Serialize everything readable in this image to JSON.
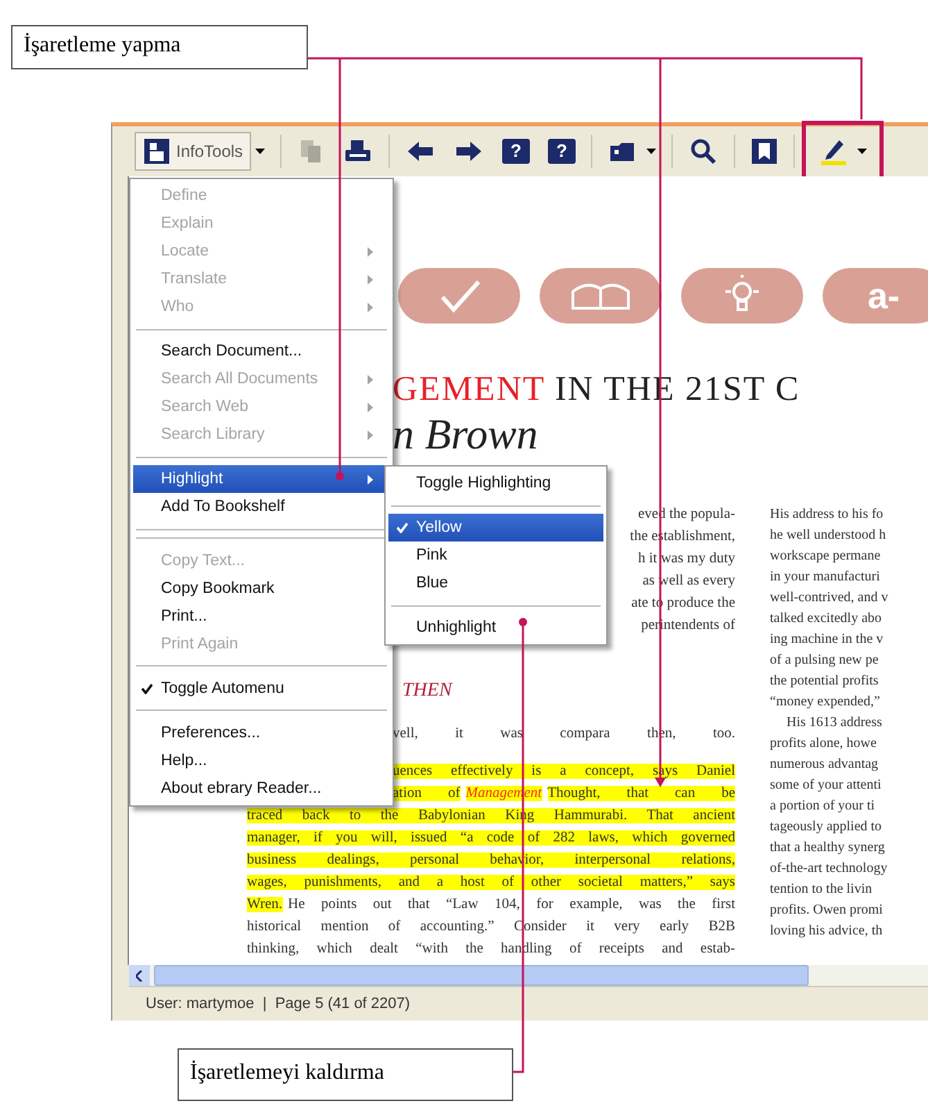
{
  "top_callout": {
    "text": "İşaretleme yapma"
  },
  "toolbar": {
    "items": [
      {
        "kind": "infotools",
        "label": "InfoTools",
        "dropdown": true,
        "disabled": false,
        "annotated": false
      },
      {
        "kind": "copy",
        "dropdown": false,
        "disabled": true,
        "annotated": false
      },
      {
        "kind": "print",
        "dropdown": false,
        "disabled": false,
        "annotated": false
      },
      {
        "kind": "back",
        "dropdown": false,
        "disabled": false,
        "annotated": false
      },
      {
        "kind": "forward",
        "dropdown": false,
        "disabled": false,
        "annotated": false
      },
      {
        "kind": "help-back",
        "glyph": "?",
        "dropdown": false,
        "disabled": false,
        "annotated": false
      },
      {
        "kind": "help-forward",
        "glyph": "?",
        "dropdown": false,
        "disabled": false,
        "annotated": false
      },
      {
        "kind": "bookmark",
        "dropdown": true,
        "disabled": false,
        "annotated": false
      },
      {
        "kind": "zoom",
        "dropdown": false,
        "disabled": false,
        "annotated": false
      },
      {
        "kind": "bookshelf",
        "dropdown": false,
        "disabled": false,
        "annotated": false
      },
      {
        "kind": "highlighter",
        "dropdown": true,
        "disabled": false,
        "annotated": true
      }
    ]
  },
  "context_menu": {
    "items": [
      {
        "kind": "item",
        "label": "Define",
        "disabled": true,
        "submenu": false,
        "checked": false,
        "selected": false
      },
      {
        "kind": "item",
        "label": "Explain",
        "disabled": true,
        "submenu": false,
        "checked": false,
        "selected": false
      },
      {
        "kind": "item",
        "label": "Locate",
        "disabled": true,
        "submenu": true,
        "checked": false,
        "selected": false
      },
      {
        "kind": "item",
        "label": "Translate",
        "disabled": true,
        "submenu": true,
        "checked": false,
        "selected": false
      },
      {
        "kind": "item",
        "label": "Who",
        "disabled": true,
        "submenu": true,
        "checked": false,
        "selected": false
      },
      {
        "kind": "separator"
      },
      {
        "kind": "item",
        "label": "Search Document...",
        "disabled": false,
        "submenu": false,
        "checked": false,
        "selected": false
      },
      {
        "kind": "item",
        "label": "Search All Documents",
        "disabled": true,
        "submenu": true,
        "checked": false,
        "selected": false
      },
      {
        "kind": "item",
        "label": "Search Web",
        "disabled": true,
        "submenu": true,
        "checked": false,
        "selected": false
      },
      {
        "kind": "item",
        "label": "Search Library",
        "disabled": true,
        "submenu": true,
        "checked": false,
        "selected": false
      },
      {
        "kind": "separator"
      },
      {
        "kind": "item",
        "label": "Highlight",
        "disabled": false,
        "submenu": true,
        "checked": false,
        "selected": true
      },
      {
        "kind": "item",
        "label": "Add To Bookshelf",
        "disabled": false,
        "submenu": false,
        "checked": false,
        "selected": false
      },
      {
        "kind": "separator"
      },
      {
        "kind": "separator"
      },
      {
        "kind": "item",
        "label": "Copy Text...",
        "disabled": true,
        "submenu": false,
        "checked": false,
        "selected": false
      },
      {
        "kind": "item",
        "label": "Copy Bookmark",
        "disabled": false,
        "submenu": false,
        "checked": false,
        "selected": false
      },
      {
        "kind": "item",
        "label": "Print...",
        "disabled": false,
        "submenu": false,
        "checked": false,
        "selected": false
      },
      {
        "kind": "item",
        "label": "Print Again",
        "disabled": true,
        "submenu": false,
        "checked": false,
        "selected": false
      },
      {
        "kind": "separator"
      },
      {
        "kind": "item",
        "label": "Toggle Automenu",
        "disabled": false,
        "submenu": false,
        "checked": true,
        "selected": false
      },
      {
        "kind": "separator"
      },
      {
        "kind": "item",
        "label": "Preferences...",
        "disabled": false,
        "submenu": false,
        "checked": false,
        "selected": false
      },
      {
        "kind": "item",
        "label": "Help...",
        "disabled": false,
        "submenu": false,
        "checked": false,
        "selected": false
      },
      {
        "kind": "item",
        "label": "About ebrary Reader...",
        "disabled": false,
        "submenu": false,
        "checked": false,
        "selected": false
      }
    ]
  },
  "submenu": {
    "items": [
      {
        "kind": "item",
        "label": "Toggle Highlighting",
        "checked": false,
        "selected": false
      },
      {
        "kind": "separator"
      },
      {
        "kind": "item",
        "label": "Yellow",
        "checked": true,
        "selected": true
      },
      {
        "kind": "item",
        "label": "Pink",
        "checked": false,
        "selected": false
      },
      {
        "kind": "item",
        "label": "Blue",
        "checked": false,
        "selected": false
      },
      {
        "kind": "separator"
      },
      {
        "kind": "item",
        "label": "Unhighlight",
        "checked": false,
        "selected": false
      }
    ]
  },
  "document": {
    "pills": [
      {
        "kind": "check"
      },
      {
        "kind": "book"
      },
      {
        "kind": "bulb"
      },
      {
        "kind": "text",
        "label": "a-"
      }
    ],
    "title_accent": "GEMENT",
    "title_rest": "IN THE 21ST C",
    "subtitle": "n Brown",
    "left_column": [
      {
        "kind": "paragraph",
        "lines": [
          {
            "kind": "end",
            "segments": [
              {
                "text": "eved the popula-",
                "highlighted": false
              }
            ]
          },
          {
            "kind": "end",
            "segments": [
              {
                "text": "the establishment,",
                "highlighted": false
              }
            ]
          },
          {
            "kind": "end",
            "segments": [
              {
                "text": "h it was my duty",
                "highlighted": false
              }
            ]
          },
          {
            "kind": "end",
            "segments": [
              {
                "text": "as well as every",
                "highlighted": false
              }
            ]
          },
          {
            "kind": "end",
            "segments": [
              {
                "text": "ate to produce the",
                "highlighted": false
              }
            ]
          },
          {
            "kind": "end",
            "segments": [
              {
                "text": "perintendents    of",
                "highlighted": false
              }
            ]
          }
        ]
      },
      {
        "kind": "heading",
        "text": "THEN"
      },
      {
        "kind": "paragraph",
        "lines": [
          {
            "kind": "start-cut",
            "segments": [
              {
                "text": "vell, it was compara then, too.",
                "highlighted": false
              }
            ]
          }
        ]
      },
      {
        "kind": "paragraph",
        "lines": [
          {
            "kind": "start-cut",
            "segments": [
              {
                "text": "uences effectively is a concept, says Daniel",
                "highlighted": true
              }
            ]
          },
          {
            "kind": "start-cut",
            "segments": [
              {
                "text": "ation of",
                "highlighted": true
              },
              {
                "text": "Management",
                "highlighted": true,
                "accent": true
              },
              {
                "text": "Thought, that can be",
                "highlighted": true
              }
            ]
          },
          {
            "kind": "full",
            "segments": [
              {
                "text": "traced back to the Babylonian King Hammurabi. That ancient",
                "highlighted": true
              }
            ]
          },
          {
            "kind": "full",
            "segments": [
              {
                "text": "manager, if you will, issued “a code of 282 laws, which governed",
                "highlighted": true
              }
            ]
          },
          {
            "kind": "full",
            "segments": [
              {
                "text": "business dealings, personal behavior, interpersonal relations,",
                "highlighted": true
              }
            ]
          },
          {
            "kind": "full",
            "segments": [
              {
                "text": "wages, punishments, and a host of other societal matters,” says",
                "highlighted": true
              }
            ]
          },
          {
            "kind": "full",
            "segments": [
              {
                "text": "Wren.",
                "highlighted": true
              },
              {
                "text": "He points out that “Law 104, for example, was the first",
                "highlighted": false
              }
            ]
          },
          {
            "kind": "full",
            "segments": [
              {
                "text": "historical mention of accounting.” Consider it very early B2B",
                "highlighted": false
              }
            ]
          },
          {
            "kind": "full",
            "segments": [
              {
                "text": "thinking, which dealt “with the handling of receipts and estab-",
                "highlighted": false
              }
            ]
          }
        ]
      }
    ],
    "right_column": [
      {
        "kind": "line",
        "text": "His address to his fo"
      },
      {
        "kind": "line",
        "text": "he well understood h"
      },
      {
        "kind": "line",
        "text": "workscape permane"
      },
      {
        "kind": "line",
        "text": "in your manufacturi"
      },
      {
        "kind": "line",
        "text": "well-contrived, and v"
      },
      {
        "kind": "line",
        "text": "talked excitedly abo"
      },
      {
        "kind": "line",
        "text": "ing machine in the v"
      },
      {
        "kind": "line",
        "text": "of a pulsing new pe"
      },
      {
        "kind": "line",
        "text": "the potential profits"
      },
      {
        "kind": "line",
        "text": "“money expended,”"
      },
      {
        "kind": "indent",
        "text": "His 1613 address"
      },
      {
        "kind": "line",
        "text": "profits alone, howe"
      },
      {
        "kind": "line",
        "text": "numerous advantag"
      },
      {
        "kind": "line",
        "text": "some of your attenti"
      },
      {
        "kind": "line",
        "text": "a portion of your ti"
      },
      {
        "kind": "line",
        "text": "tageously applied to"
      },
      {
        "kind": "line",
        "text": "that a healthy synerg"
      },
      {
        "kind": "line",
        "text": "of-the-art technology"
      },
      {
        "kind": "line",
        "text": "tention to the livin"
      },
      {
        "kind": "line",
        "text": "profits. Owen promi"
      },
      {
        "kind": "line",
        "text": "loving his advice, th"
      }
    ]
  },
  "status_bar": {
    "text": "User: martymoe  |  Page 5 (41 of 2207)"
  },
  "bottom_callout": {
    "text": "İşaretlemeyi kaldırma"
  }
}
